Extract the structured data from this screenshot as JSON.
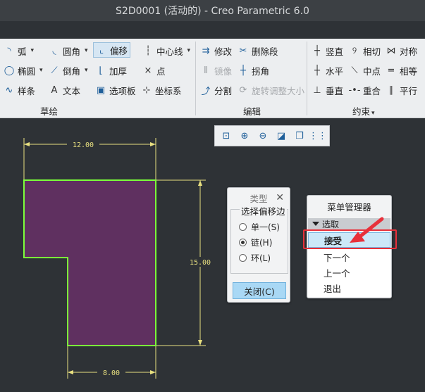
{
  "window": {
    "title": "S2D0001 (活动的) - Creo Parametric 6.0"
  },
  "ribbon": {
    "sketch_group": {
      "label": "草绘",
      "buttons": {
        "arc": "弧",
        "fillet": "圆角",
        "offset": "偏移",
        "centerline": "中心线",
        "ellipse": "椭圆",
        "chamfer": "倒角",
        "thicken": "加厚",
        "point": "点",
        "spline": "样条",
        "text": "文本",
        "palette": "选项板",
        "coordsys": "坐标系"
      }
    },
    "edit_group": {
      "label": "编辑",
      "buttons": {
        "modify": "修改",
        "delete_segment": "删除段",
        "mirror": "镜像",
        "corner": "拐角",
        "divide": "分割",
        "rotate_resize": "旋转调整大小"
      }
    },
    "constrain_group": {
      "label": "约束",
      "buttons": {
        "vertical": "竖直",
        "tangent": "相切",
        "symmetric": "对称",
        "horizontal": "水平",
        "midpoint": "中点",
        "equal": "相等",
        "perpendicular": "垂直",
        "coincident": "重合",
        "parallel": "平行"
      }
    }
  },
  "sketch": {
    "fill_color": "#5f3060",
    "edge_color": "#7cff3a",
    "dims": {
      "top": "12.00",
      "right": "15.00",
      "bottom": "8.00"
    }
  },
  "type_dialog": {
    "title": "类型",
    "group_label": "选择偏移边",
    "options": [
      {
        "label": "单一(S)",
        "selected": false
      },
      {
        "label": "链(H)",
        "selected": true
      },
      {
        "label": "环(L)",
        "selected": false
      }
    ],
    "close_label": "关闭(C)"
  },
  "menu_manager": {
    "title": "菜单管理器",
    "section": "选取",
    "items": [
      "接受",
      "下一个",
      "上一个",
      "退出"
    ],
    "selected_index": 0
  },
  "colors": {
    "highlight_red": "#e8303a",
    "accent_blue": "#a9d8f5"
  }
}
